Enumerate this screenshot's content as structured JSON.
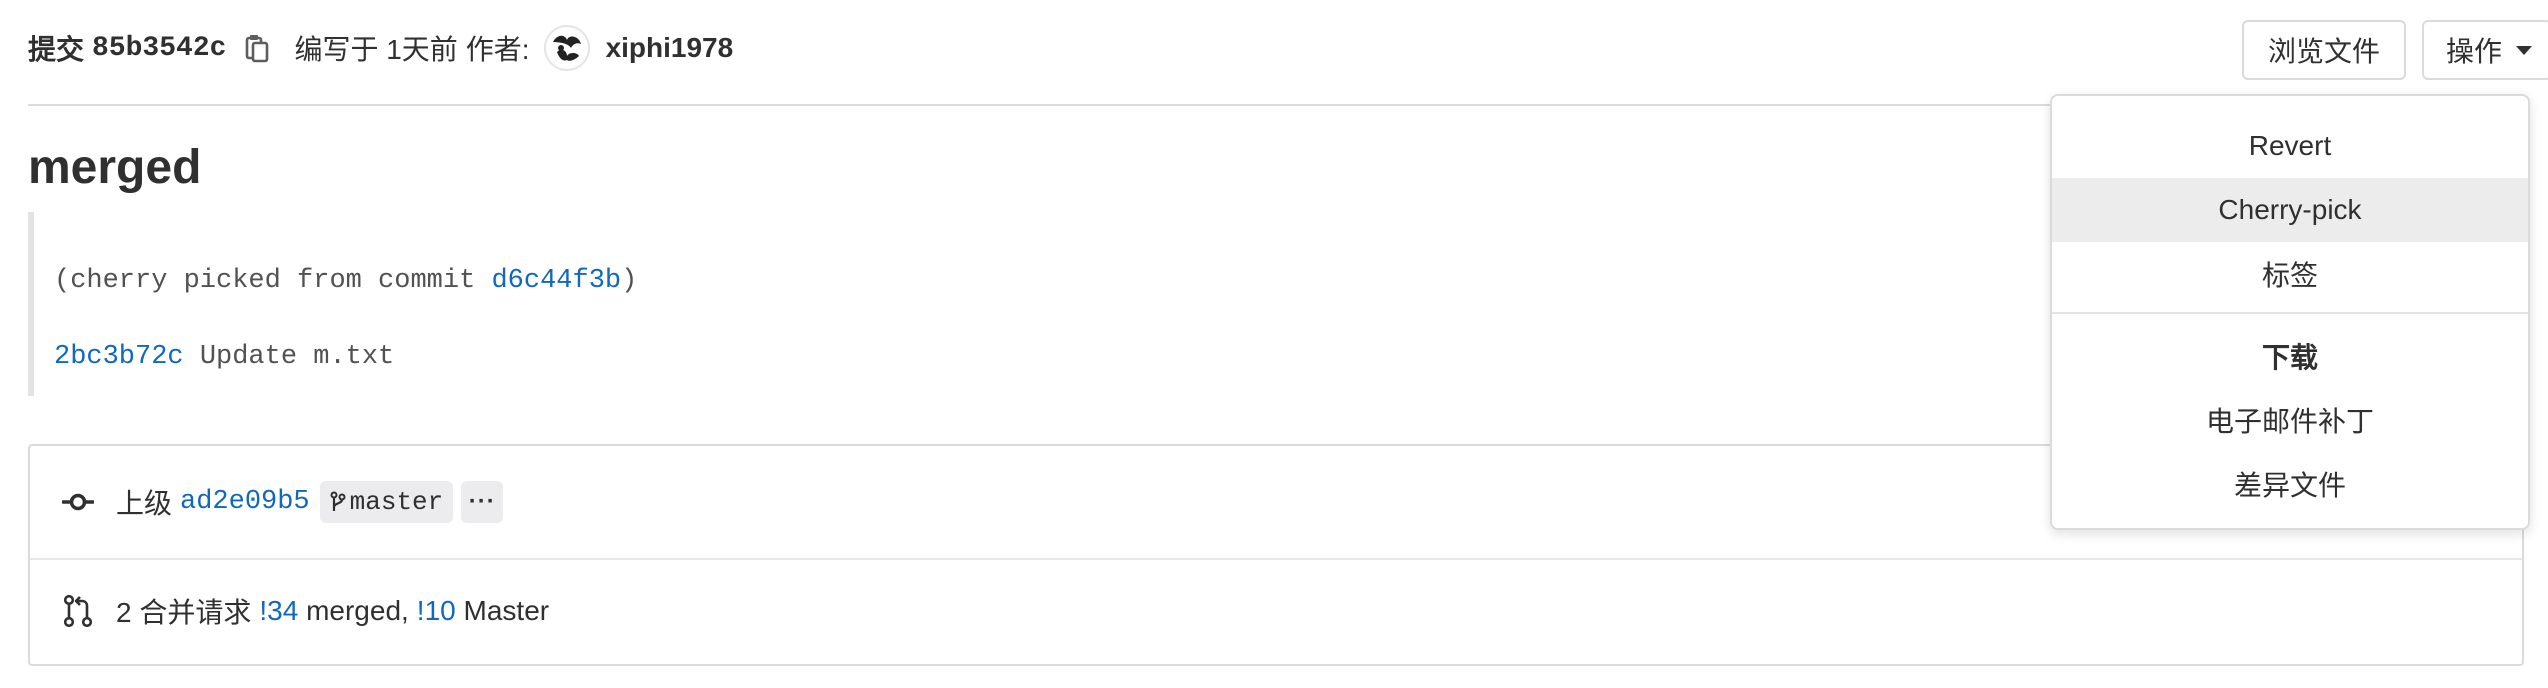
{
  "header": {
    "commit_label": "提交",
    "commit_sha": "85b3542c",
    "authored_text": "编写于 1天前",
    "by_label": "作者:",
    "author_name": "xiphi1978",
    "browse_files_label": "浏览文件",
    "options_label": "操作"
  },
  "commit": {
    "title": "merged",
    "description": {
      "line1_prefix": "(cherry picked from commit ",
      "line1_sha": "d6c44f3b",
      "line1_suffix": ")",
      "line2_sha": "2bc3b72c",
      "line2_text": " Update m.txt"
    }
  },
  "info": {
    "parent_label": "上级",
    "parent_sha": "ad2e09b5",
    "branch_name": "master",
    "more_label": "···",
    "mr_count_text": "2 合并请求",
    "mr1_ref": "!34",
    "mr1_title": " merged,",
    "mr2_ref": "!10",
    "mr2_title": " Master"
  },
  "dropdown": {
    "items": [
      "Revert",
      "Cherry-pick",
      "标签"
    ],
    "active_index": 1,
    "download_header": "下载",
    "download_items": [
      "电子邮件补丁",
      "差异文件"
    ]
  },
  "colors": {
    "link": "#1068bf",
    "border": "#dbdbdb",
    "active_item_bg": "#ececec"
  },
  "icons": [
    "copy-icon",
    "avatar",
    "chevron-down-icon",
    "commit-icon",
    "branch-icon",
    "merge-request-icon"
  ]
}
